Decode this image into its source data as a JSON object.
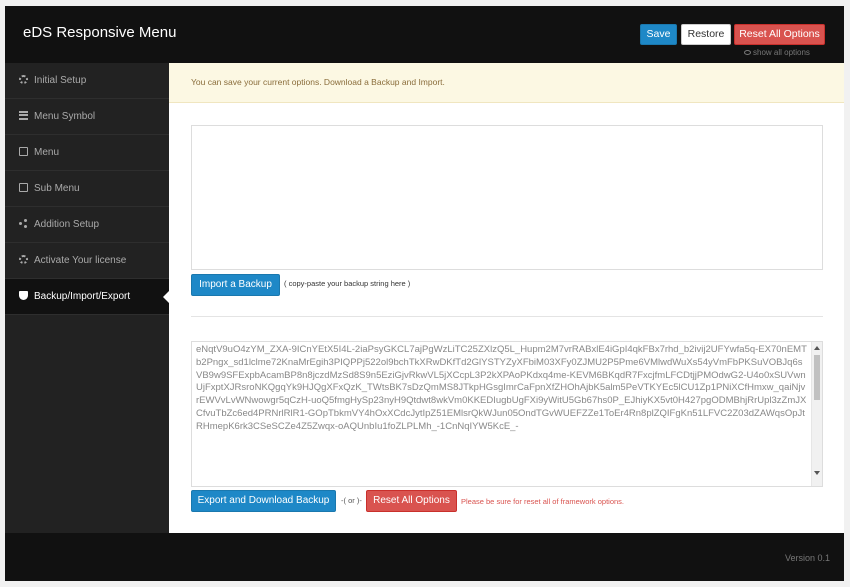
{
  "header": {
    "title": "eDS Responsive Menu",
    "save_label": "Save",
    "restore_label": "Restore",
    "reset_label": "Reset All Options",
    "show_all_label": "show all options"
  },
  "sidebar": {
    "items": [
      {
        "label": "Initial Setup",
        "icon": "gear-icon"
      },
      {
        "label": "Menu Symbol",
        "icon": "bars-icon"
      },
      {
        "label": "Menu",
        "icon": "mobile-icon"
      },
      {
        "label": "Sub Menu",
        "icon": "mobile-icon"
      },
      {
        "label": "Addition Setup",
        "icon": "share-icon"
      },
      {
        "label": "Activate Your license",
        "icon": "cogs-icon"
      },
      {
        "label": "Backup/Import/Export",
        "icon": "shield-icon",
        "active": true
      }
    ]
  },
  "main": {
    "notice": "You can save your current options. Download a Backup and Import.",
    "import_textarea_value": "",
    "import_button": "Import a Backup",
    "import_hint": "( copy-paste your backup string here )",
    "export_text": "eNqtV9uO4zYM_ZXA-9ICnYEtX5I4L-2iaPsyGKCL7ajPgWzLiTC25ZXlzQ5L_Hupm2M7vrRABxlE4iGpI4qkFBx7rhd_b2ivij2UFYwfa5q-EX70nEMTb2Pngx_sd1lclme72KnaMrEgih3PIQPPj522ol9bchTkXRwDKfTd2GlYSTYZyXFbiM03XFy0ZJMU2P5Pme6VMlwdWuXs54yVmFbPKSuVOBJq6sVB9w9SFExpbAcamBP8n8jczdMzSd8S9n5EziGjvRkwVL5jXCcpL3P2kXPAoPKdxq4me-KEVM6BKqdR7FxcjfmLFCDtjjPMOdwG2-U4o0xSUVwnUjFxptXJRsroNKQgqYk9HJQgXFxQzK_TWtsBK7sDzQmMS8JTkpHGsgImrCaFpnXfZHOhAjbK5alm5PeVTKYEc5lCU1Zp1PNiXCfHmxw_qaiNjvrEWVvLvWNwowgr5qCzH-uoQ5fmgHySp23nyH9Qtdwt8wkVm0KKEDIugbUgFXi9yWitU5Gb67hs0P_EJhiyKX5vt0H427pgODMBhjRrUpl3zZmJXCfvuTbZc6ed4PRNrlRlR1-GOpTbkmVY4hOxXCdcJytIpZ51EMlsrQkWJun05OndTGvWUEFZZe1ToEr4Rn8plZQIFgKn51LFVC2Z03dZAWqsOpJtRHmepK6rk3CSeSCZe4Z5Zwqx-oAQUnbIu1foZLPLMh_-1CnNqIYW5KcE_-",
    "export_button": "Export and Download Backup",
    "or_text": "-( or )-",
    "reset_button": "Reset All Options",
    "warning": "Please be sure for reset all of framework options."
  },
  "footer": {
    "version": "Version 0.1"
  }
}
